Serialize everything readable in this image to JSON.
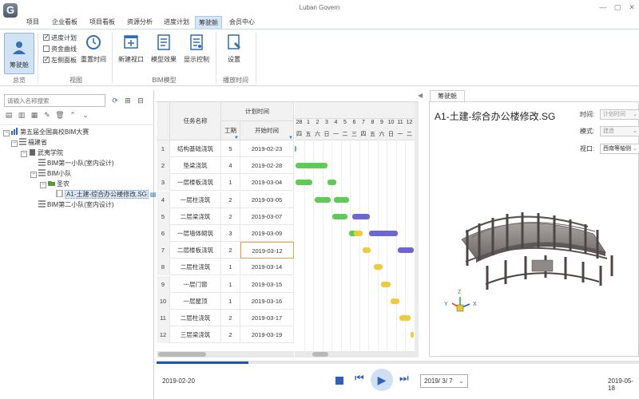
{
  "window": {
    "title": "Luban Govern",
    "logo": "G",
    "min": "—",
    "max": "▢",
    "close": "✕"
  },
  "menu": [
    {
      "label": "项目",
      "active": false
    },
    {
      "label": "企业看板",
      "active": false
    },
    {
      "label": "项目看板",
      "active": false
    },
    {
      "label": "资源分析",
      "active": false
    },
    {
      "label": "进度计划",
      "active": false
    },
    {
      "label": "筹驶舱",
      "active": true
    },
    {
      "label": "会员中心",
      "active": false
    }
  ],
  "ribbon": {
    "overview_btn": "筹驶舱",
    "checks": [
      {
        "label": "进度计划",
        "checked": true
      },
      {
        "label": "资金曲线",
        "checked": false
      },
      {
        "label": "左侧面板",
        "checked": true
      }
    ],
    "reset_btn": "重置时间",
    "new_window_btn": "新建视口",
    "model_effect_btn": "模型效果",
    "display_ctrl_btn": "显示控制",
    "settings_btn": "设置",
    "groups": {
      "overview": "总览",
      "view": "视图",
      "bim": "BIM模型",
      "playback": "播放时间"
    }
  },
  "left": {
    "search_placeholder": "请输入名称搜索",
    "tree": [
      {
        "label": "第五届全国高校BIM大赛",
        "level": 0,
        "expand": "−"
      },
      {
        "label": "福建省",
        "level": 1,
        "expand": "−"
      },
      {
        "label": "武夷学院",
        "level": 2,
        "expand": "−"
      },
      {
        "label": "BIM第一小队(室内设计)",
        "level": 3,
        "expand": ""
      },
      {
        "label": "BIM小队",
        "level": 3,
        "expand": "−"
      },
      {
        "label": "圣农",
        "level": 4,
        "expand": "−"
      },
      {
        "label": "A1-土建-综合办公楼修改.SG",
        "level": 5,
        "expand": "",
        "selected": true
      },
      {
        "label": "BIM第二小队(室内设计)",
        "level": 3,
        "expand": ""
      }
    ]
  },
  "gantt": {
    "headers": {
      "task": "任务名称",
      "plan_time": "计划时间",
      "duration": "工期",
      "start": "开始时间"
    },
    "days": [
      "28",
      "1",
      "2",
      "3",
      "4",
      "5",
      "6",
      "7",
      "8",
      "9",
      "10",
      "11",
      "12"
    ],
    "weekdays": [
      "四",
      "五",
      "六",
      "日",
      "一",
      "二",
      "三",
      "四",
      "五",
      "六",
      "日",
      "一",
      "二"
    ],
    "rows": [
      {
        "n": "1",
        "task": "结构基础浇筑",
        "dur": "5",
        "start": "2019-02-23"
      },
      {
        "n": "2",
        "task": "垫梁浇筑",
        "dur": "4",
        "start": "2019-02-28"
      },
      {
        "n": "3",
        "task": "一层楼板浇筑",
        "dur": "1",
        "start": "2019-03-04"
      },
      {
        "n": "4",
        "task": "一层柱浇筑",
        "dur": "2",
        "start": "2019-03-05"
      },
      {
        "n": "5",
        "task": "二层梁浇筑",
        "dur": "2",
        "start": "2019-03-07"
      },
      {
        "n": "6",
        "task": "一层墙体砌筑",
        "dur": "3",
        "start": "2019-03-09"
      },
      {
        "n": "7",
        "task": "二层楼板浇筑",
        "dur": "2",
        "start": "2019-03-12"
      },
      {
        "n": "8",
        "task": "二层柱浇筑",
        "dur": "1",
        "start": "2019-03-14"
      },
      {
        "n": "9",
        "task": "一层门窗",
        "dur": "1",
        "start": "2019-03-15"
      },
      {
        "n": "10",
        "task": "一层屋顶",
        "dur": "1",
        "start": "2019-03-16"
      },
      {
        "n": "11",
        "task": "二层柱浇筑",
        "dur": "2",
        "start": "2019-03-17"
      },
      {
        "n": "12",
        "task": "三层梁浇筑",
        "dur": "2",
        "start": "2019-03-19"
      }
    ],
    "bars": [
      {
        "row": 0,
        "s": 0,
        "e": 0.2,
        "color": "green"
      },
      {
        "row": 1,
        "s": 0.1,
        "e": 3.6,
        "color": "green"
      },
      {
        "row": 2,
        "s": 0.1,
        "e": 1.9,
        "color": "green"
      },
      {
        "row": 2,
        "s": 3.6,
        "e": 4.5,
        "color": "green"
      },
      {
        "row": 3,
        "s": 2.2,
        "e": 3.9,
        "color": "green"
      },
      {
        "row": 3,
        "s": 4.3,
        "e": 5.9,
        "color": "green"
      },
      {
        "row": 4,
        "s": 4.1,
        "e": 5.7,
        "color": "green"
      },
      {
        "row": 4,
        "s": 6.3,
        "e": 8.2,
        "color": "purple"
      },
      {
        "row": 5,
        "s": 5.9,
        "e": 6.9,
        "color": "green"
      },
      {
        "row": 5,
        "s": 6.4,
        "e": 7.4,
        "color": "yellow"
      },
      {
        "row": 5,
        "s": 8.1,
        "e": 11.2,
        "color": "purple"
      },
      {
        "row": 6,
        "s": 7.4,
        "e": 8.3,
        "color": "yellow"
      },
      {
        "row": 6,
        "s": 11.2,
        "e": 13.0,
        "color": "purple"
      },
      {
        "row": 7,
        "s": 8.6,
        "e": 9.6,
        "color": "yellow"
      },
      {
        "row": 8,
        "s": 9.4,
        "e": 10.4,
        "color": "yellow"
      },
      {
        "row": 9,
        "s": 10.4,
        "e": 11.4,
        "color": "yellow"
      },
      {
        "row": 10,
        "s": 11.4,
        "e": 12.6,
        "color": "yellow"
      },
      {
        "row": 11,
        "s": 12.6,
        "e": 13.0,
        "color": "yellow"
      }
    ]
  },
  "viewer": {
    "tab": "筹驶舱",
    "title": "A1-土建-综合办公楼修改.SG",
    "time_label": "时间:",
    "time_value": "计划时间",
    "mode_label": "模式:",
    "mode_value": "建造",
    "view_label": "视口:",
    "view_value": "西南等轴侧"
  },
  "playback": {
    "start_date": "2019-02-20",
    "end_date": "2019-05-18",
    "current": "2019/ 3/ 7",
    "progress_percent": 19
  }
}
